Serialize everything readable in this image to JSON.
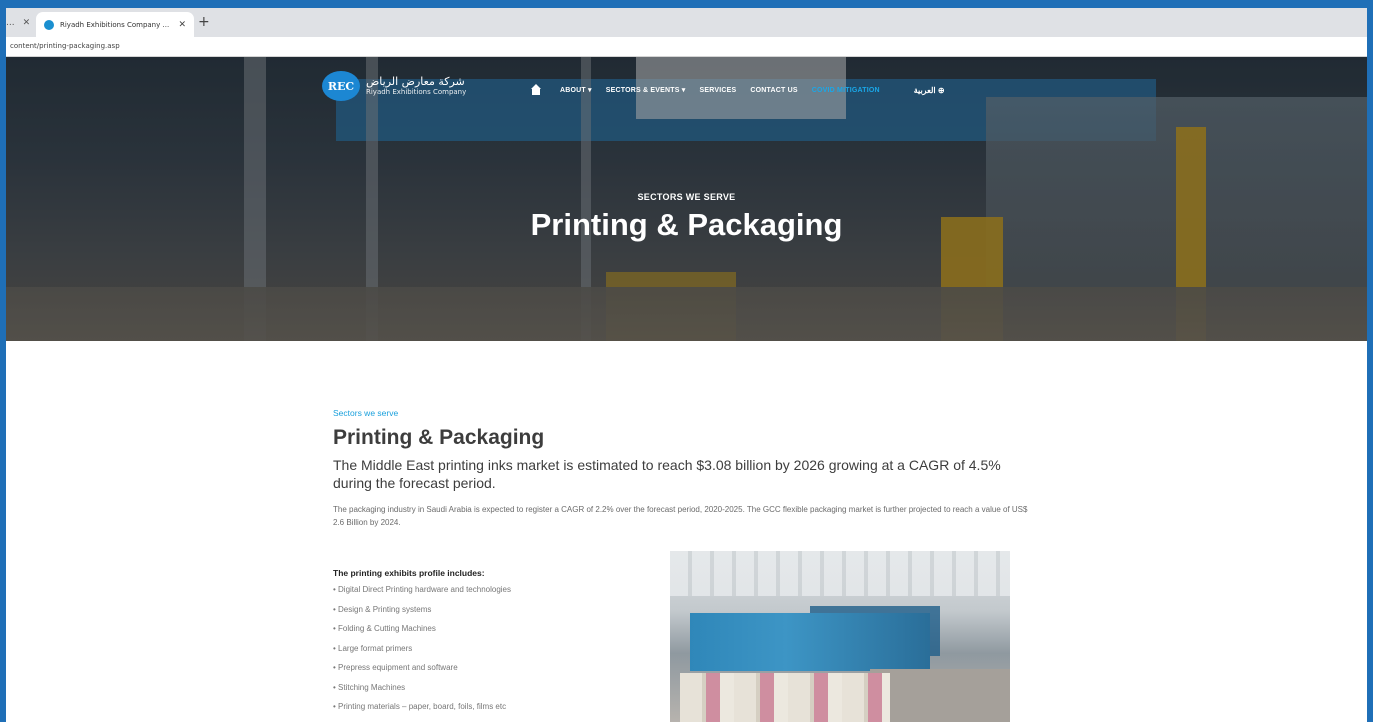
{
  "browser": {
    "prev_tab_title": "...",
    "active_tab_title": "Riyadh Exhibitions Company ...",
    "url": "content/printing-packaging.asp"
  },
  "site": {
    "logo_badge": "REC",
    "logo_arabic": "شركة معارض الرياض",
    "logo_english": "Riyadh Exhibitions Company",
    "nav": {
      "about": "ABOUT ▾",
      "sectors": "SECTORS & EVENTS ▾",
      "services": "SERVICES",
      "contact": "CONTACT US",
      "covid": "COVID MITIGATION",
      "language": "العربية ⊕"
    }
  },
  "hero": {
    "eyebrow": "SECTORS WE SERVE",
    "title": "Printing & Packaging"
  },
  "content": {
    "eyebrow": "Sectors we serve",
    "title": "Printing & Packaging",
    "lead": "The Middle East printing inks market is estimated to reach $3.08 billion by 2026 growing at a CAGR of 4.5% during the forecast period.",
    "paragraph": "The packaging industry in Saudi Arabia is expected to register a CAGR of 2.2% over the forecast period, 2020-2025. The GCC flexible packaging market is further projected to reach a value of US$ 2.6 Billion by 2024.",
    "profile_heading": "The printing exhibits profile includes:",
    "profile_items": [
      "• Digital Direct Printing hardware and technologies",
      "• Design & Printing systems",
      "• Folding & Cutting Machines",
      "• Large format primers",
      "• Prepress equipment and software",
      "• Stitching Machines",
      "• Printing materials – paper, board, foils, films etc"
    ]
  },
  "colors": {
    "accent": "#1aa0dc",
    "frame": "#1f6fb7"
  }
}
